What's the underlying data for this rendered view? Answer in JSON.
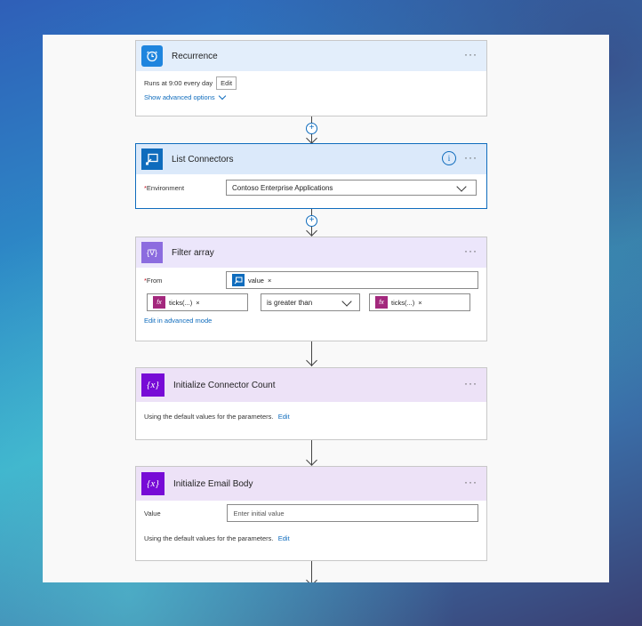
{
  "recurrence": {
    "title": "Recurrence",
    "runs_text": "Runs at 9:00 every day",
    "edit_label": "Edit",
    "advanced_link": "Show advanced options"
  },
  "list_connectors": {
    "title": "List Connectors",
    "environment_label": "Environment",
    "environment_value": "Contoso Enterprise Applications"
  },
  "filter_array": {
    "title": "Filter array",
    "from_label": "From",
    "from_token": "value",
    "left_token": "ticks(...)",
    "operator": "is greater than",
    "right_token": "ticks(...)",
    "advanced_mode_link": "Edit in advanced mode"
  },
  "init_connector_count": {
    "title": "Initialize Connector Count",
    "default_text": "Using the default values for the parameters.",
    "edit_link": "Edit"
  },
  "init_email_body": {
    "title": "Initialize Email Body",
    "value_label": "Value",
    "value_placeholder": "Enter initial value",
    "default_text": "Using the default values for the parameters.",
    "edit_link": "Edit"
  },
  "common": {
    "more_glyph": "···",
    "token_remove": "×",
    "asterisk": "*",
    "info_glyph": "i",
    "plus_glyph": "+",
    "fx_glyph": "fx",
    "var_glyph": "{x}",
    "filter_glyph": "{∇}"
  },
  "colors": {
    "recurrence_header": "#e3eefb",
    "list_connectors_header": "#dbe9fa",
    "filter_header": "#ece6fb",
    "variable_header": "#ede2f7",
    "variable_icon": "#770bd6",
    "filter_icon": "#8c6cdf",
    "power_icon": "#0f6cbd",
    "fx_icon": "#a3287d"
  }
}
